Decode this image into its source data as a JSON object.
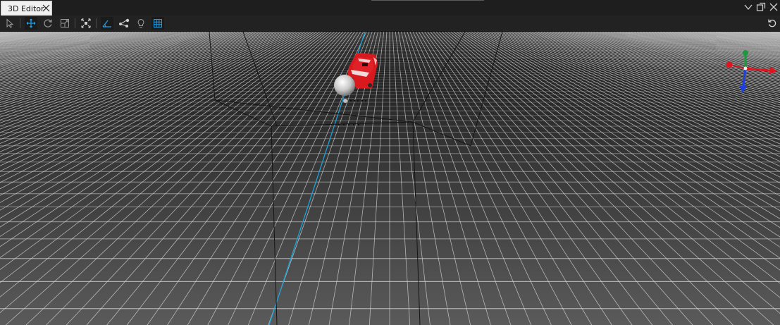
{
  "tab": {
    "title": "3D Editor"
  },
  "window_buttons": [
    "chevron-down-icon",
    "float-window-icon",
    "close-icon"
  ],
  "toolbar": {
    "left_tools": [
      "select-icon",
      "move-icon",
      "rotate-icon",
      "scale-icon",
      "center-icon",
      "camera-icon",
      "light-add-icon",
      "bulb-icon",
      "grid-icon"
    ],
    "active_tools": [
      "move-icon",
      "camera-icon",
      "grid-icon"
    ],
    "right_tools": [
      "reset-view-icon"
    ]
  },
  "colors": {
    "accent": "#1e9fe6",
    "tab_bg": "#f0f0f0",
    "grid_line": "#d8d8d8",
    "viewport_top": "#1b1b1b",
    "viewport_bottom": "#5a5a5a",
    "z_axis_line": "#1aa3d9",
    "car": "#d8191d",
    "gizmo_x": "#e0141e",
    "gizmo_y": "#1a9a3c",
    "gizmo_z": "#1d3fe0"
  },
  "viewport": {
    "objects": [
      "ground-grid",
      "bounding-box",
      "car-model",
      "light-sphere",
      "axis-gizmo"
    ]
  }
}
